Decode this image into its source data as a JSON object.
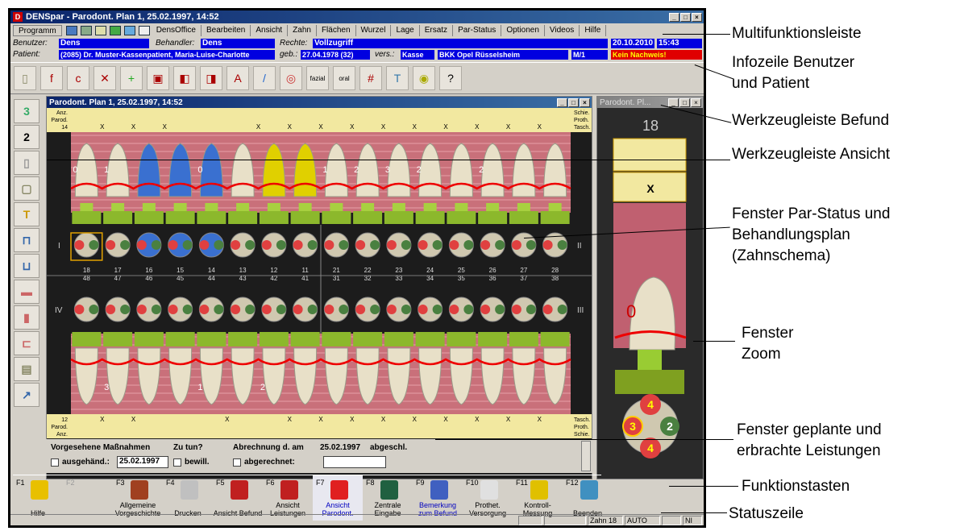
{
  "window": {
    "title": "DENSpar - Parodont. Plan 1, 25.02.1997, 14:52"
  },
  "menu": {
    "items": [
      "Programm",
      "DensOffice",
      "Bearbeiten",
      "Ansicht",
      "Zahn",
      "Flächen",
      "Wurzel",
      "Lage",
      "Ersatz",
      "Par-Status",
      "Optionen",
      "Videos",
      "Hilfe"
    ]
  },
  "info": {
    "benutzer_label": "Benutzer:",
    "benutzer": "Dens",
    "behandler_label": "Behandler:",
    "behandler": "Dens",
    "rechte_label": "Rechte:",
    "rechte": "Vollzugriff",
    "date": "20.10.2010",
    "time": "15:43",
    "patient_label": "Patient:",
    "patient": "(2085) Dr. Muster-Kassenpatient, Maria-Luise-Charlotte",
    "geb_label": "geb.:",
    "geb": "27.04.1978 (32)",
    "vers_label": "vers.:",
    "vers": "Kasse",
    "kasse": "BKK Opel Rüsselsheim",
    "status": "M/1",
    "nachweis": "Kein Nachweis!"
  },
  "toolbar": {
    "fazial": "fazial",
    "oral": "oral"
  },
  "chart_window": {
    "title": "Parodont. Plan 1, 25.02.1997, 14:52",
    "top_row_labels": [
      "Anz.",
      "Parod.",
      "14"
    ],
    "top_right_labels": [
      "Schie.",
      "Proth.",
      "Tasch."
    ],
    "bottom_row_labels": [
      "12",
      "Parod.",
      "Anz."
    ],
    "bottom_right_labels": [
      "Tasch.",
      "Proth.",
      "Schie."
    ],
    "quadrants": [
      "I",
      "II",
      "III",
      "IV"
    ],
    "upper_teeth": [
      "18",
      "17",
      "16",
      "15",
      "14",
      "13",
      "12",
      "11",
      "21",
      "22",
      "23",
      "24",
      "25",
      "26",
      "27",
      "28"
    ],
    "lower_teeth": [
      "48",
      "47",
      "46",
      "45",
      "44",
      "43",
      "42",
      "41",
      "31",
      "32",
      "33",
      "34",
      "35",
      "36",
      "37",
      "38"
    ],
    "top_x": [
      "X",
      "X",
      "X",
      "",
      "",
      "X",
      "X",
      "X",
      "X",
      "X",
      "X",
      "X",
      "X",
      "X",
      "X"
    ],
    "bottom_x": [
      "X",
      "X",
      "",
      "",
      "X",
      "",
      "X",
      "X",
      "X",
      "X",
      "X",
      "X",
      "X",
      "X",
      "X"
    ]
  },
  "zoom_window": {
    "title": "Parodont. Pl...",
    "tooth": "18",
    "mark": "X",
    "root_num": "0",
    "surfaces": [
      "4",
      "3",
      "2",
      "4"
    ]
  },
  "measures": {
    "heading1": "Vorgesehene Maßnahmen",
    "heading2": "Zu tun?",
    "heading3": "Abrechnung d. am",
    "heading3_date": "25.02.1997",
    "heading3_status": "abgeschl.",
    "check1": "ausgehänd.:",
    "check1_date": "25.02.1997",
    "check2": "bewill.",
    "check3": "abgerechnet:"
  },
  "fkeys": [
    {
      "key": "F1",
      "label": "Hilfe",
      "color": "#e8c000"
    },
    {
      "key": "F2",
      "label": "",
      "color": ""
    },
    {
      "key": "F3",
      "label": "Allgemeine Vorgeschichte",
      "color": "#a04020"
    },
    {
      "key": "F4",
      "label": "Drucken",
      "color": "#c0c0c0"
    },
    {
      "key": "F5",
      "label": "Ansicht Befund",
      "color": "#c02020"
    },
    {
      "key": "F6",
      "label": "Ansicht Leistungen",
      "color": "#c02020"
    },
    {
      "key": "F7",
      "label": "Ansicht Parodont.",
      "color": "#e02020"
    },
    {
      "key": "F8",
      "label": "Zentrale Eingabe",
      "color": "#206040"
    },
    {
      "key": "F9",
      "label": "Bemerkung zum Befund",
      "color": "#4060c0"
    },
    {
      "key": "F10",
      "label": "Prothet. Versorgung",
      "color": "#e0e0e0"
    },
    {
      "key": "F11",
      "label": "Kontroll-Messung",
      "color": "#e0c000"
    },
    {
      "key": "F12",
      "label": "Beenden",
      "color": "#4090c0"
    }
  ],
  "statusbar": {
    "tooth": "Zahn 18",
    "mode": "AUTO",
    "ni": "NI"
  },
  "callouts": [
    {
      "text": "Multifunktionsleiste"
    },
    {
      "text": "Infozeile Benutzer"
    },
    {
      "text": "und Patient"
    },
    {
      "text": "Werkzeugleiste Befund"
    },
    {
      "text": "Werkzeugleiste Ansicht"
    },
    {
      "text": "Fenster Par-Status und"
    },
    {
      "text": "Behandlungsplan"
    },
    {
      "text": "(Zahnschema)"
    },
    {
      "text": "Fenster"
    },
    {
      "text": "Zoom"
    },
    {
      "text": "Fenster geplante und"
    },
    {
      "text": "erbrachte Leistungen"
    },
    {
      "text": "Funktionstasten"
    },
    {
      "text": "Statuszeile"
    }
  ]
}
